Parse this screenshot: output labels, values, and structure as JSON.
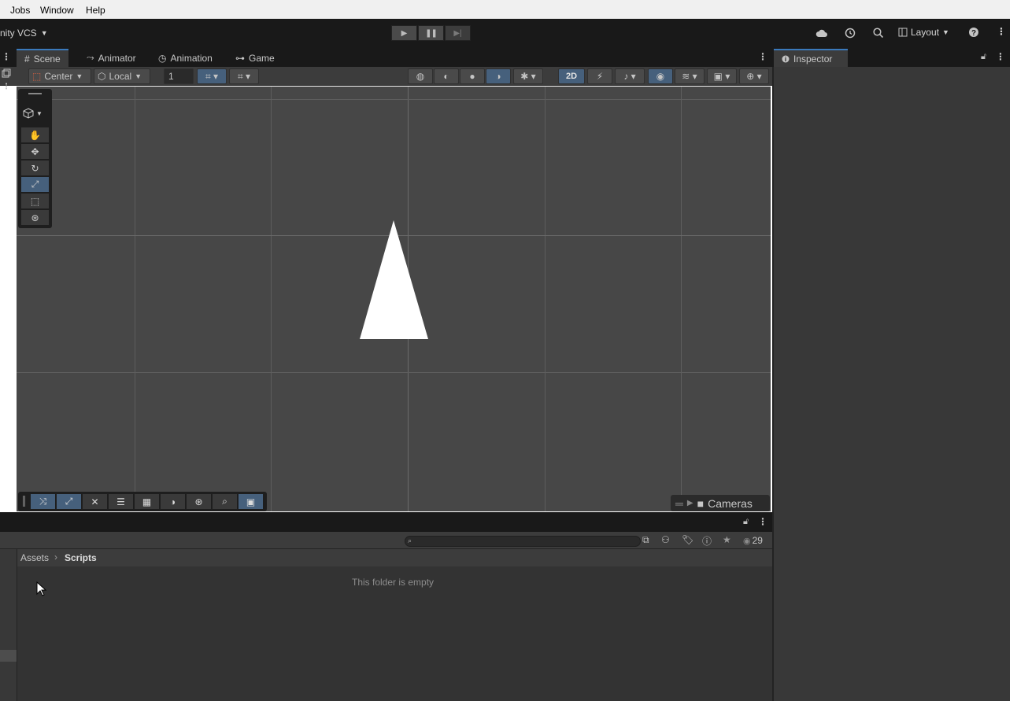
{
  "menu": {
    "items": [
      "Jobs",
      "Window",
      "Help"
    ]
  },
  "toolbar": {
    "vcs_label": "nity VCS",
    "layout_label": "Layout"
  },
  "scene_tabs": [
    {
      "label": "Scene",
      "icon": "grid-icon"
    },
    {
      "label": "Animator",
      "icon": "animator-icon"
    },
    {
      "label": "Animation",
      "icon": "clock-icon"
    },
    {
      "label": "Game",
      "icon": "gamepad-icon"
    }
  ],
  "scene_toolbar": {
    "pivot_mode": "Center",
    "pivot_rotation": "Local",
    "grid_size": "1",
    "mode_2d": "2D"
  },
  "viewport": {
    "overlay_cameras": "Cameras"
  },
  "inspector": {
    "tab_label": "Inspector"
  },
  "project": {
    "breadcrumb": [
      "Assets",
      "Scripts"
    ],
    "empty_message": "This folder is empty",
    "hidden_count": "29"
  },
  "colors": {
    "accent": "#46607c",
    "tab_highlight": "#3a79bb",
    "viewport_bg": "#474747",
    "sprite": "#ffffff"
  }
}
